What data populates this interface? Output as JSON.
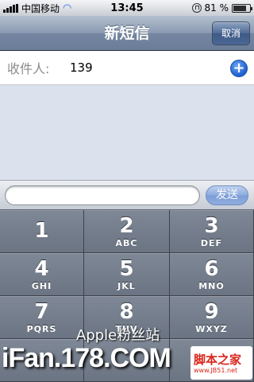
{
  "status_bar": {
    "carrier": "中国移动",
    "time": "13:45",
    "battery_percent": "81 %",
    "battery_level": 0.81
  },
  "nav": {
    "title": "新短信",
    "cancel_label": "取消"
  },
  "recipient": {
    "label": "收件人:",
    "value": "139"
  },
  "compose": {
    "value": "",
    "send_label": "发送"
  },
  "keypad": {
    "keys": [
      {
        "digit": "1",
        "letters": ""
      },
      {
        "digit": "2",
        "letters": "ABC"
      },
      {
        "digit": "3",
        "letters": "DEF"
      },
      {
        "digit": "4",
        "letters": "GHI"
      },
      {
        "digit": "5",
        "letters": "JKL"
      },
      {
        "digit": "6",
        "letters": "MNO"
      },
      {
        "digit": "7",
        "letters": "PQRS"
      },
      {
        "digit": "8",
        "letters": "TUV"
      },
      {
        "digit": "9",
        "letters": "WXYZ"
      },
      {
        "digit": "",
        "letters": ""
      },
      {
        "digit": "",
        "letters": ""
      },
      {
        "digit": "",
        "letters": ""
      }
    ]
  },
  "watermark": {
    "line1": "Apple粉丝站",
    "line2": "iFan.178.COM",
    "logo_text": "脚本之家",
    "logo_sub": "www.JB51.net"
  },
  "colors": {
    "nav_bar": "#7486a1",
    "cancel_button": "#4f6a96",
    "add_contact": "#1c5fcf",
    "send_button": "#7ea2de",
    "keypad": "#6b7482"
  }
}
